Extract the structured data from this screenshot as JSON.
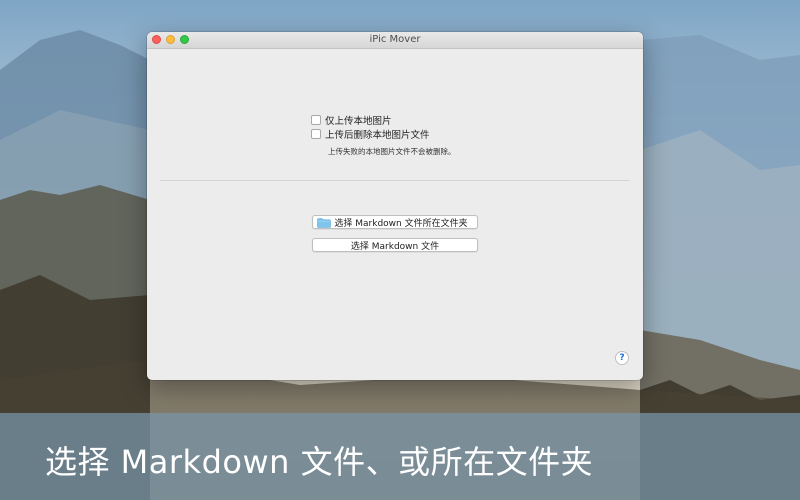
{
  "window": {
    "title": "iPic Mover"
  },
  "options": {
    "upload_local_only_label": "仅上传本地图片",
    "upload_local_only_checked": false,
    "delete_after_upload_label": "上传后删除本地图片文件",
    "delete_after_upload_checked": false,
    "hint": "上传失败的本地图片文件不会被删除。"
  },
  "actions": {
    "choose_folder_label": "选择 Markdown 文件所在文件夹",
    "choose_folder_icon": "folder-icon",
    "choose_file_label": "选择 Markdown 文件"
  },
  "help": {
    "label": "?"
  },
  "caption": {
    "text": "选择 Markdown 文件、或所在文件夹"
  }
}
